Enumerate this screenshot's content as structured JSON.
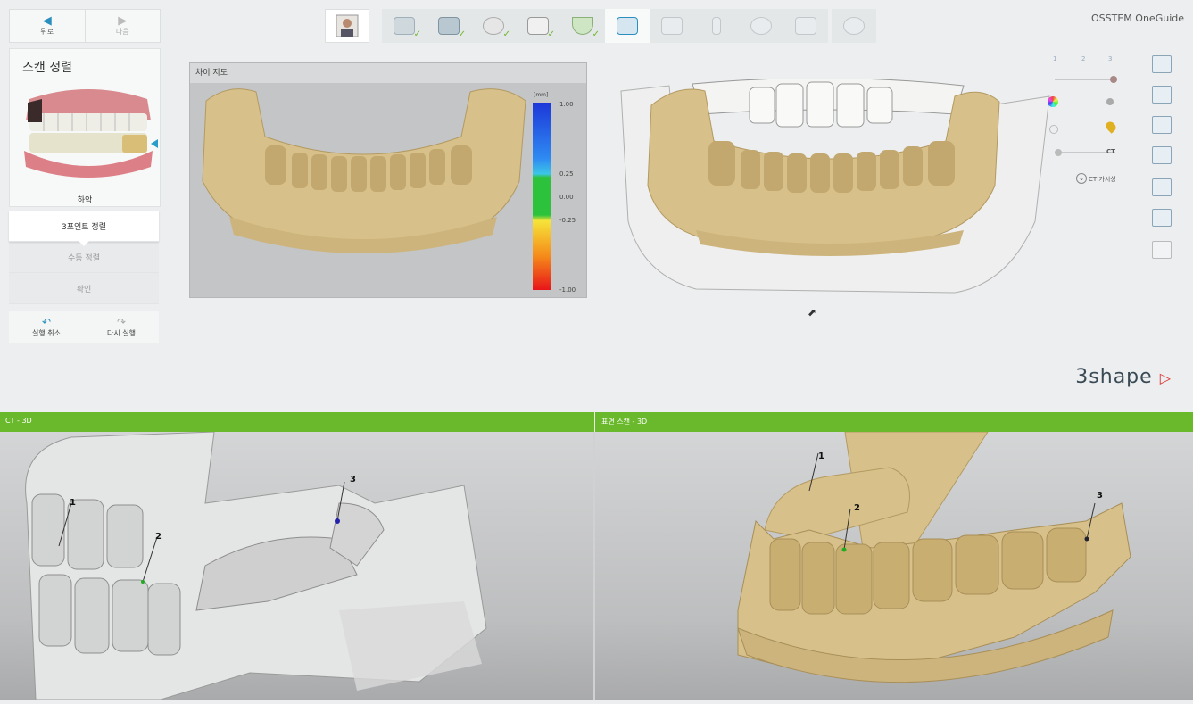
{
  "nav": {
    "back": "뒤로",
    "next": "다음"
  },
  "panel": {
    "title": "스캔 정렬",
    "jaw_label": "하악"
  },
  "steps": [
    {
      "label": "3포인트 정렬",
      "active": true
    },
    {
      "label": "수동 정렬",
      "active": false
    },
    {
      "label": "확인",
      "active": false
    }
  ],
  "undo": {
    "undo": "실행 취소",
    "redo": "다시 실행"
  },
  "brand": "OSSTEM OneGuide",
  "logo": "3shape",
  "toolbar": {
    "icons": [
      "patient-photo-icon",
      "scan-import-icon",
      "model-icon",
      "crown-icon",
      "panel-icon",
      "arch-icon",
      "alignment-icon",
      "guide-icon",
      "implant-icon",
      "sleeve-icon",
      "export-icon",
      "settings-icon"
    ],
    "checked": [
      true,
      true,
      true,
      true,
      true,
      false,
      false,
      false,
      false,
      false
    ]
  },
  "diffmap": {
    "title": "차이 지도",
    "unit": "[mm]",
    "scale_labels": [
      "1.00",
      "0.25",
      "0.00",
      "-0.25",
      "-1.00"
    ]
  },
  "visibility": {
    "ct_label": "CT",
    "ct_visibility": "CT 가시성",
    "stops": [
      "1",
      "2",
      "3"
    ]
  },
  "bottom": {
    "left_title": "CT - 3D",
    "right_title": "표면 스캔 - 3D"
  },
  "landmarks": {
    "left": [
      "1",
      "2",
      "3"
    ],
    "right": [
      "1",
      "2",
      "3"
    ]
  },
  "colors": {
    "accent": "#2a8fbf",
    "green_bar": "#6ab92d",
    "bone": "#d8c08a"
  }
}
